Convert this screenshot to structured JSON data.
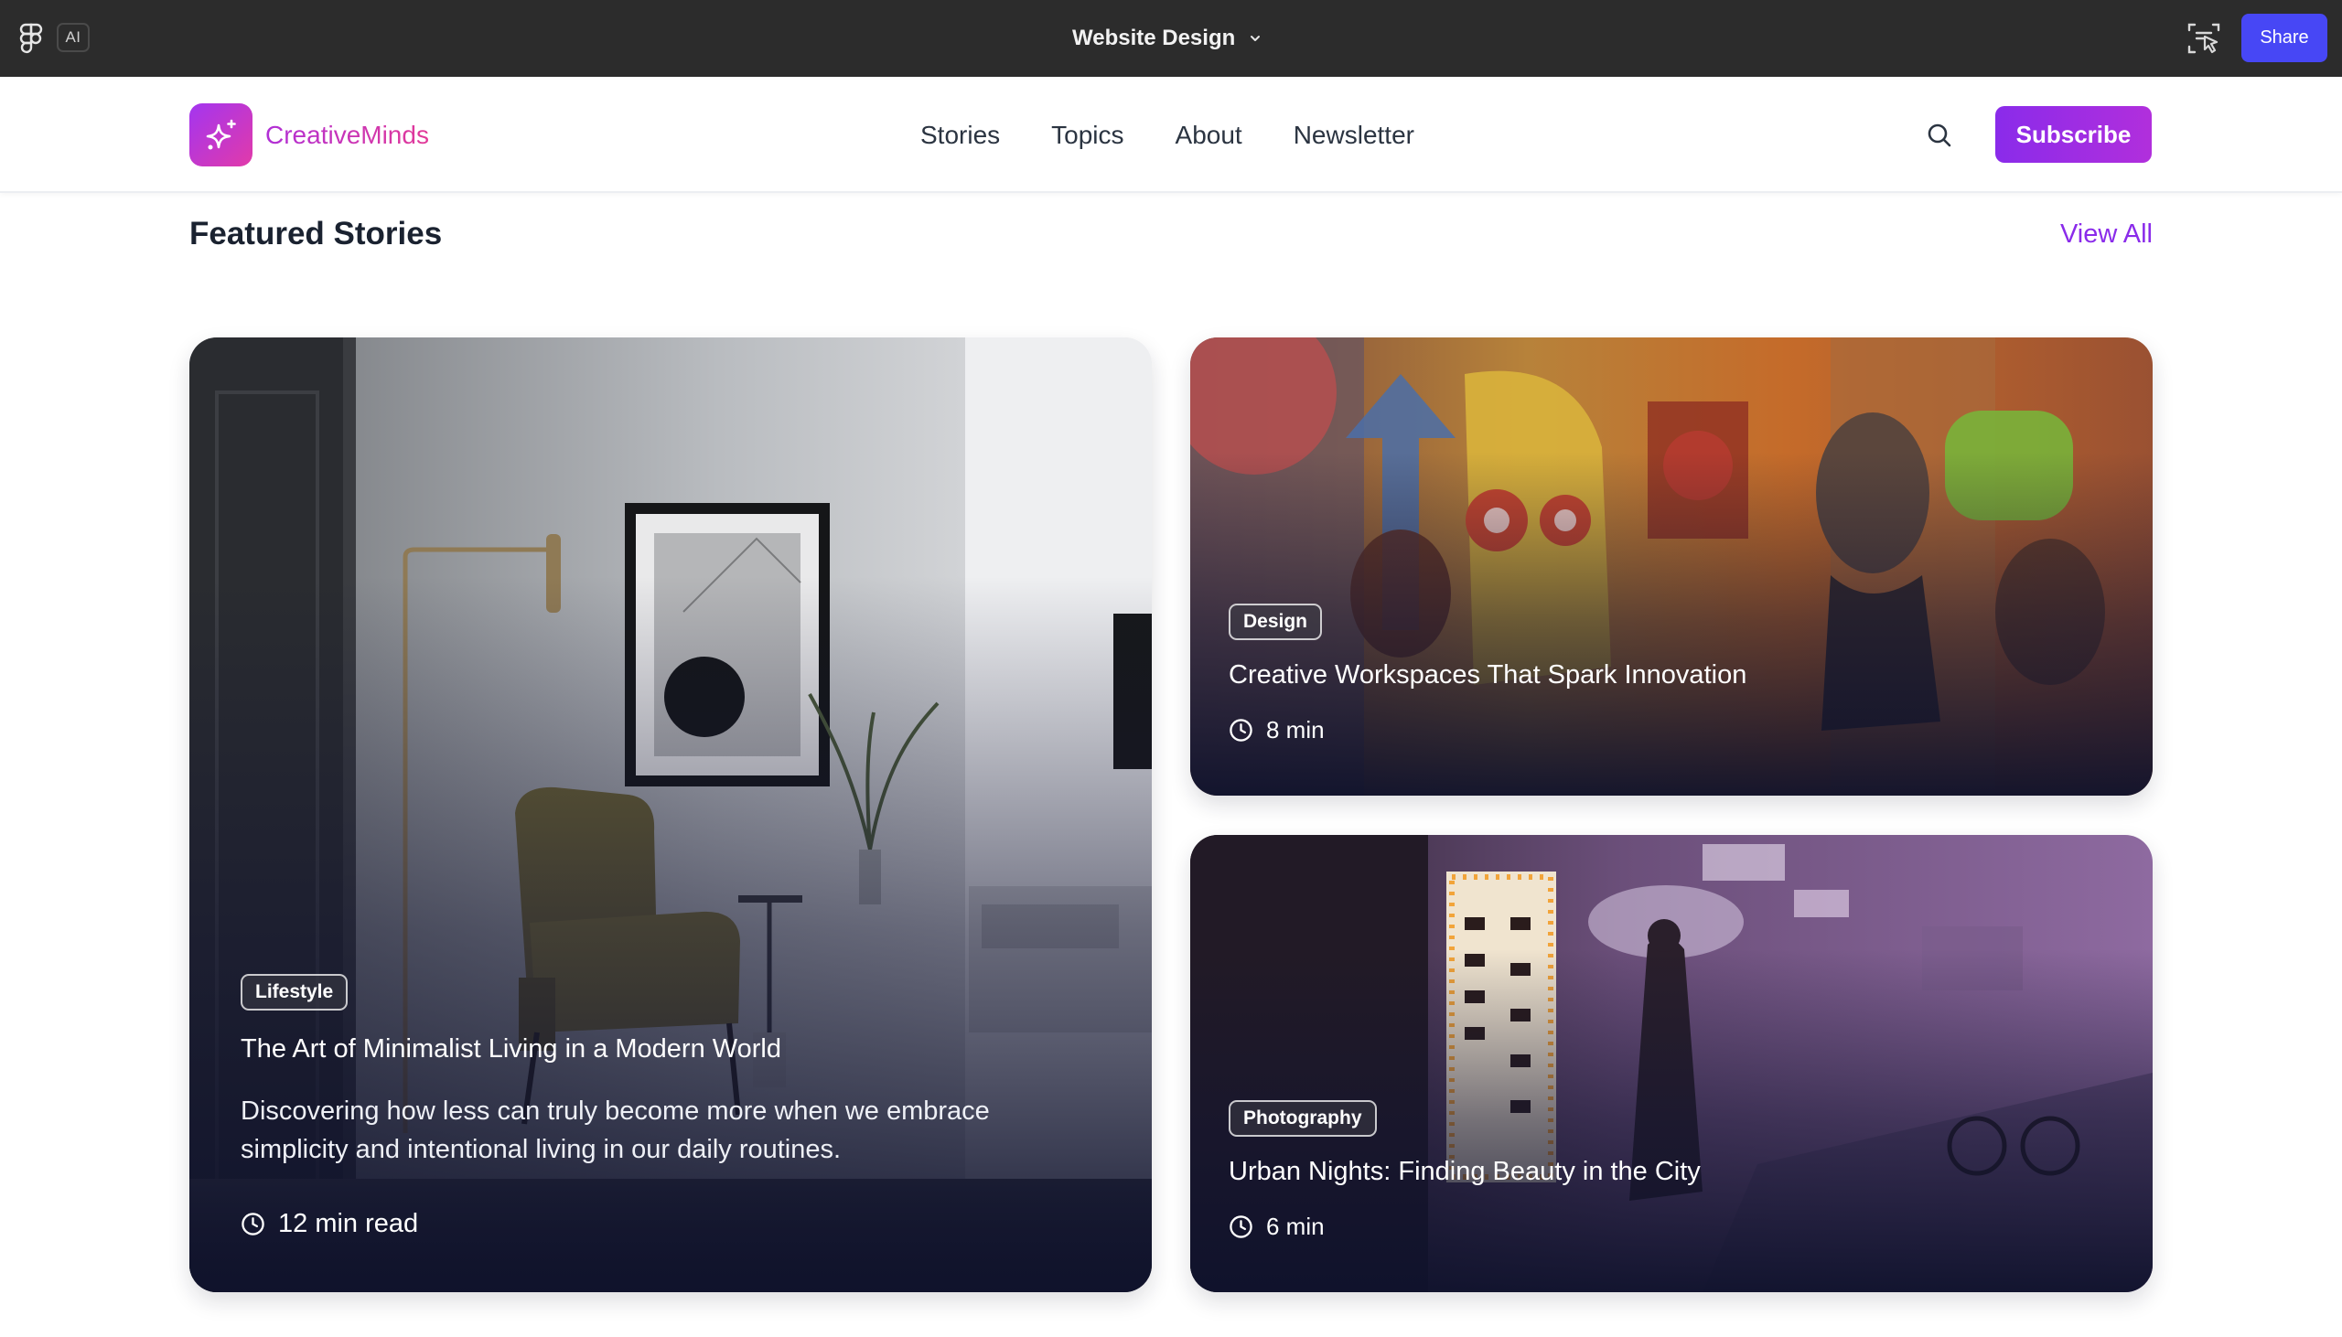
{
  "figma": {
    "ai_label": "AI",
    "file_title": "Website Design",
    "share_label": "Share"
  },
  "site": {
    "brand_name": "CreativeMinds",
    "nav": [
      "Stories",
      "Topics",
      "About",
      "Newsletter"
    ],
    "subscribe_label": "Subscribe",
    "accent": "#8a2bea"
  },
  "section": {
    "title": "Featured Stories",
    "view_all": "View All"
  },
  "stories": [
    {
      "tag": "Lifestyle",
      "title": "The Art of Minimalist Living in a Modern World",
      "excerpt": "Discovering how less can truly become more when we embrace simplicity and intentional living in our daily routines.",
      "read_time": "12 min read",
      "image": "minimalist-interior-photo"
    },
    {
      "tag": "Design",
      "title": "Creative Workspaces That Spark Innovation",
      "read_time": "8 min",
      "image": "graffiti-wall-photo"
    },
    {
      "tag": "Photography",
      "title": "Urban Nights: Finding Beauty in the City",
      "read_time": "6 min",
      "image": "neon-alley-photo"
    }
  ]
}
